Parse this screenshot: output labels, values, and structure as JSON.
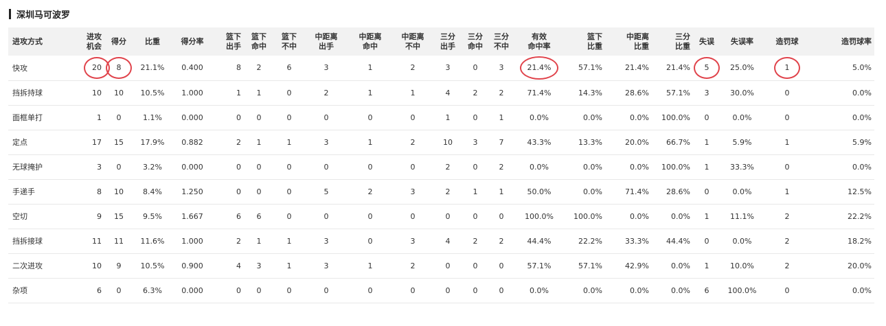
{
  "title": "深圳马可波罗",
  "highlight_color": "#e0434b",
  "columns": [
    {
      "label": "进攻方式",
      "align": "left"
    },
    {
      "label": "进攻\n机会",
      "align": "right"
    },
    {
      "label": "得分",
      "align": "center"
    },
    {
      "label": "比重",
      "align": "center"
    },
    {
      "label": "得分率",
      "align": "center"
    },
    {
      "label": "篮下\n出手",
      "align": "right"
    },
    {
      "label": "篮下\n命中",
      "align": "center"
    },
    {
      "label": "篮下\n不中",
      "align": "center"
    },
    {
      "label": "中距离\n出手",
      "align": "center"
    },
    {
      "label": "中距离\n命中",
      "align": "center"
    },
    {
      "label": "中距离\n不中",
      "align": "center"
    },
    {
      "label": "三分\n出手",
      "align": "center"
    },
    {
      "label": "三分\n命中",
      "align": "center"
    },
    {
      "label": "三分\n不中",
      "align": "center"
    },
    {
      "label": "有效\n命中率",
      "align": "center"
    },
    {
      "label": "篮下\n比重",
      "align": "right"
    },
    {
      "label": "中距离\n比重",
      "align": "right"
    },
    {
      "label": "三分\n比重",
      "align": "right"
    },
    {
      "label": "失误",
      "align": "center"
    },
    {
      "label": "失误率",
      "align": "center"
    },
    {
      "label": "造罚球",
      "align": "center"
    },
    {
      "label": "造罚球率",
      "align": "right"
    }
  ],
  "rows": [
    [
      "快攻",
      "20",
      "8",
      "21.1%",
      "0.400",
      "8",
      "2",
      "6",
      "3",
      "1",
      "2",
      "3",
      "0",
      "3",
      "21.4%",
      "57.1%",
      "21.4%",
      "21.4%",
      "5",
      "25.0%",
      "1",
      "5.0%"
    ],
    [
      "挡拆持球",
      "10",
      "10",
      "10.5%",
      "1.000",
      "1",
      "1",
      "0",
      "2",
      "1",
      "1",
      "4",
      "2",
      "2",
      "71.4%",
      "14.3%",
      "28.6%",
      "57.1%",
      "3",
      "30.0%",
      "0",
      "0.0%"
    ],
    [
      "面框单打",
      "1",
      "0",
      "1.1%",
      "0.000",
      "0",
      "0",
      "0",
      "0",
      "0",
      "0",
      "1",
      "0",
      "1",
      "0.0%",
      "0.0%",
      "0.0%",
      "100.0%",
      "0",
      "0.0%",
      "0",
      "0.0%"
    ],
    [
      "定点",
      "17",
      "15",
      "17.9%",
      "0.882",
      "2",
      "1",
      "1",
      "3",
      "1",
      "2",
      "10",
      "3",
      "7",
      "43.3%",
      "13.3%",
      "20.0%",
      "66.7%",
      "1",
      "5.9%",
      "1",
      "5.9%"
    ],
    [
      "无球掩护",
      "3",
      "0",
      "3.2%",
      "0.000",
      "0",
      "0",
      "0",
      "0",
      "0",
      "0",
      "2",
      "0",
      "2",
      "0.0%",
      "0.0%",
      "0.0%",
      "100.0%",
      "1",
      "33.3%",
      "0",
      "0.0%"
    ],
    [
      "手递手",
      "8",
      "10",
      "8.4%",
      "1.250",
      "0",
      "0",
      "0",
      "5",
      "2",
      "3",
      "2",
      "1",
      "1",
      "50.0%",
      "0.0%",
      "71.4%",
      "28.6%",
      "0",
      "0.0%",
      "1",
      "12.5%"
    ],
    [
      "空切",
      "9",
      "15",
      "9.5%",
      "1.667",
      "6",
      "6",
      "0",
      "0",
      "0",
      "0",
      "0",
      "0",
      "0",
      "100.0%",
      "100.0%",
      "0.0%",
      "0.0%",
      "1",
      "11.1%",
      "2",
      "22.2%"
    ],
    [
      "挡拆接球",
      "11",
      "11",
      "11.6%",
      "1.000",
      "2",
      "1",
      "1",
      "3",
      "0",
      "3",
      "4",
      "2",
      "2",
      "44.4%",
      "22.2%",
      "33.3%",
      "44.4%",
      "0",
      "0.0%",
      "2",
      "18.2%"
    ],
    [
      "二次进攻",
      "10",
      "9",
      "10.5%",
      "0.900",
      "4",
      "3",
      "1",
      "3",
      "1",
      "2",
      "0",
      "0",
      "0",
      "57.1%",
      "57.1%",
      "42.9%",
      "0.0%",
      "1",
      "10.0%",
      "2",
      "20.0%"
    ],
    [
      "杂项",
      "6",
      "0",
      "6.3%",
      "0.000",
      "0",
      "0",
      "0",
      "0",
      "0",
      "0",
      "0",
      "0",
      "0",
      "0.0%",
      "0.0%",
      "0.0%",
      "0.0%",
      "6",
      "100.0%",
      "0",
      "0.0%"
    ]
  ],
  "circled_cells": [
    [
      0,
      1
    ],
    [
      0,
      2
    ],
    [
      0,
      14
    ],
    [
      0,
      18
    ],
    [
      0,
      20
    ]
  ]
}
